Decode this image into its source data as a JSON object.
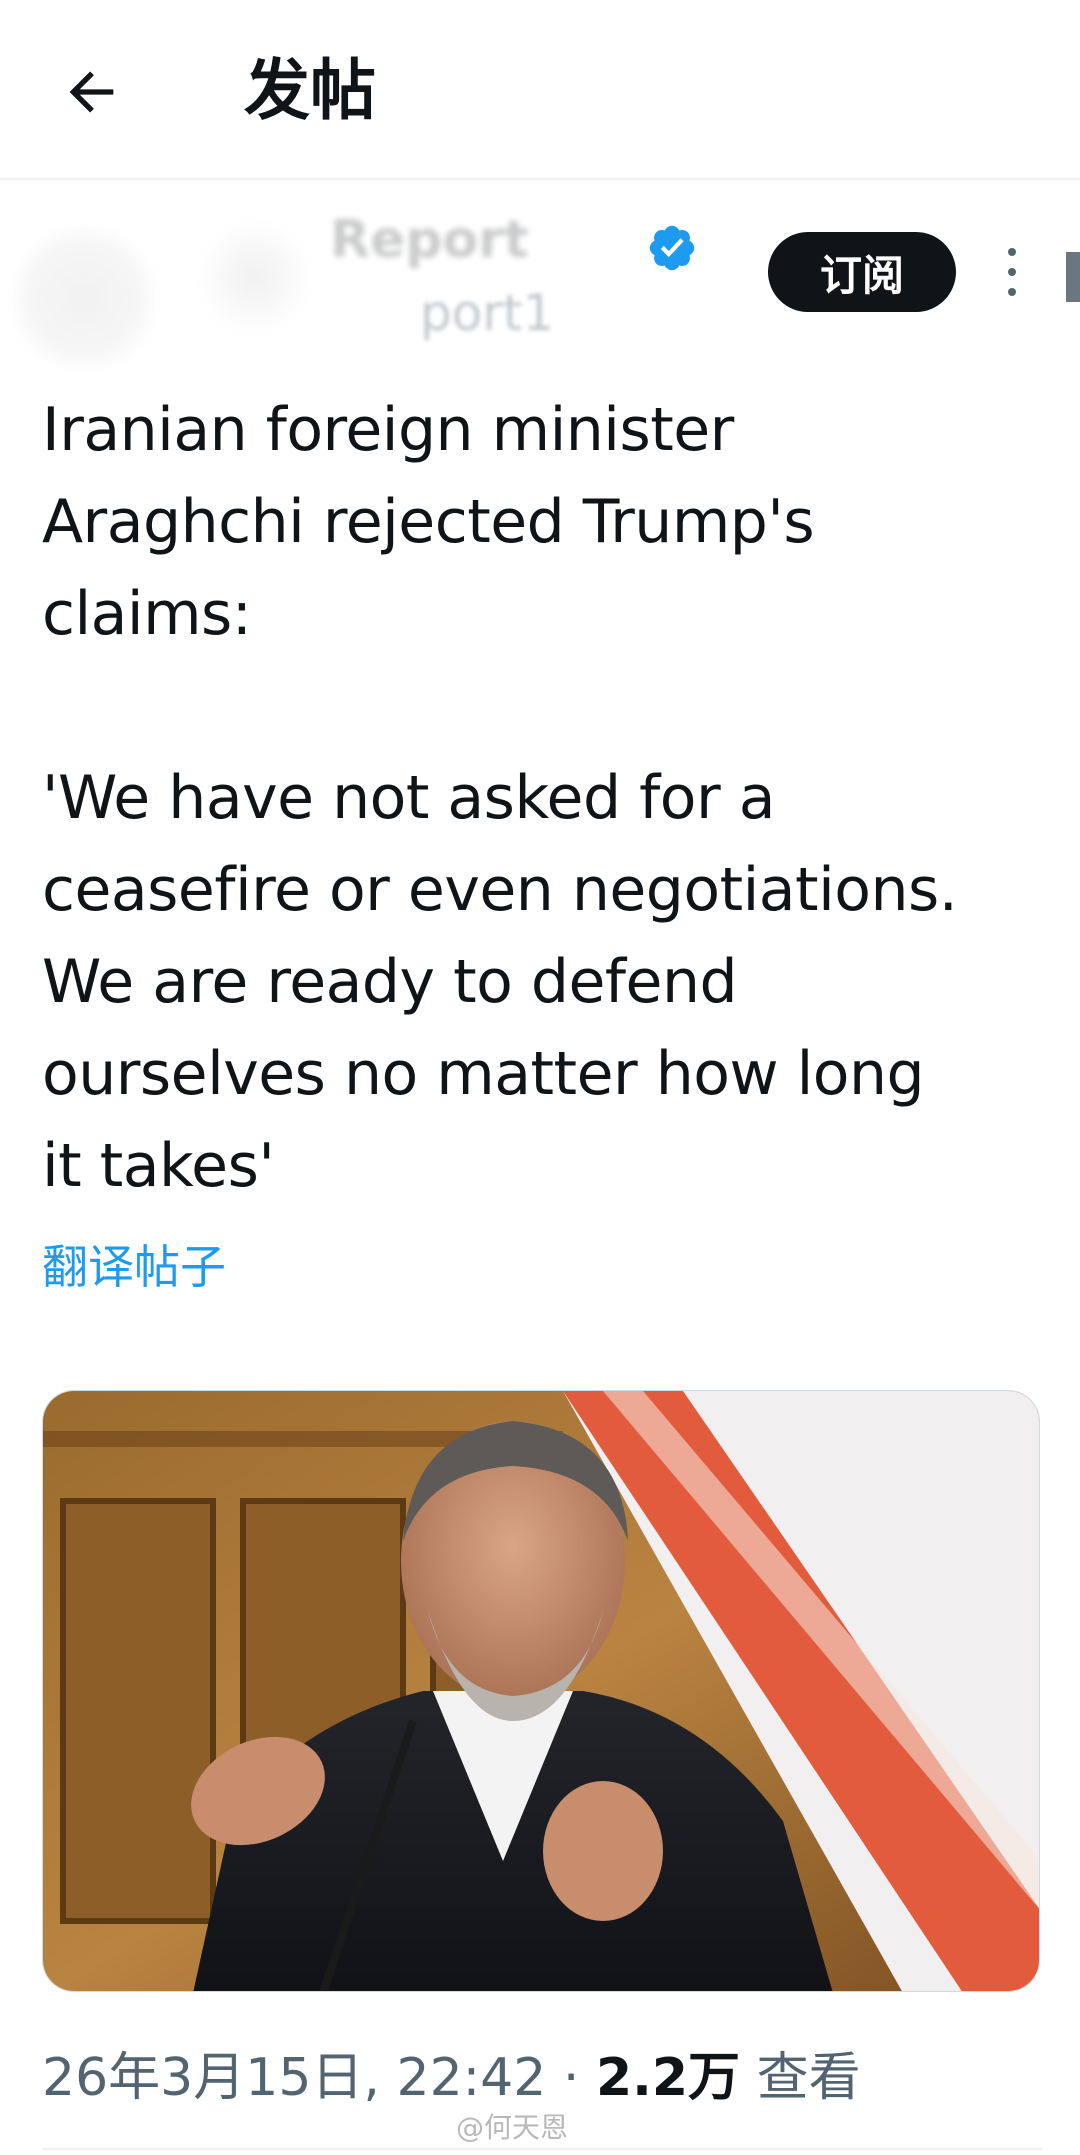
{
  "header": {
    "back_icon": "arrow-left-icon",
    "title": "发帖"
  },
  "author": {
    "display_name": "Report",
    "handle": "port1",
    "verified": true,
    "subscribe_label": "订阅",
    "more_icon": "more-vertical-icon"
  },
  "tweet": {
    "text": "Iranian foreign minister\nAraghchi rejected Trump's\nclaims:\n\n'We have not asked for a\nceasefire or even negotiations.\nWe are ready to defend\nourselves no matter how long\nit takes'",
    "translate_label": "翻译帖子"
  },
  "media": {
    "alt": ""
  },
  "meta": {
    "date": "26年3月15日",
    "time": "22:42",
    "separator": "·",
    "views_count": "2.2万",
    "views_label": "查看"
  },
  "watermark": "@何天恩",
  "colors": {
    "accent": "#1d9bf0",
    "text_primary": "#0f1419",
    "text_secondary": "#536471",
    "button_bg": "#0f1419"
  }
}
